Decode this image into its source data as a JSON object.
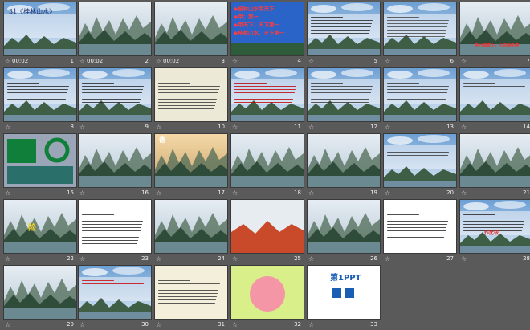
{
  "view": "slide-sorter",
  "slides": [
    {
      "number": "1",
      "timing": "00:02",
      "heading": "31《桂林山水》"
    },
    {
      "number": "2",
      "timing": "00:02"
    },
    {
      "number": "3",
      "timing": "00:02"
    },
    {
      "number": "4",
      "timing": "",
      "lines": [
        "◆桂林山水甲天下",
        "◆甲：第一",
        "◆甲天下：天下第一",
        "◆桂林山水，天下第一"
      ]
    },
    {
      "number": "5",
      "timing": ""
    },
    {
      "number": "6",
      "timing": ""
    },
    {
      "number": "7",
      "timing": "",
      "caption": "舟行碧波上，人在画中游"
    },
    {
      "number": "8",
      "timing": ""
    },
    {
      "number": "9",
      "timing": ""
    },
    {
      "number": "10",
      "timing": ""
    },
    {
      "number": "11",
      "timing": ""
    },
    {
      "number": "12",
      "timing": ""
    },
    {
      "number": "13",
      "timing": ""
    },
    {
      "number": "14",
      "timing": ""
    },
    {
      "number": "15",
      "timing": ""
    },
    {
      "number": "16",
      "timing": ""
    },
    {
      "number": "17",
      "timing": "",
      "caption": "奇"
    },
    {
      "number": "18",
      "timing": ""
    },
    {
      "number": "19",
      "timing": ""
    },
    {
      "number": "20",
      "timing": ""
    },
    {
      "number": "21",
      "timing": ""
    },
    {
      "number": "22",
      "timing": "",
      "caption": "险"
    },
    {
      "number": "23",
      "timing": ""
    },
    {
      "number": "24",
      "timing": ""
    },
    {
      "number": "25",
      "timing": ""
    },
    {
      "number": "26",
      "timing": ""
    },
    {
      "number": "27",
      "timing": ""
    },
    {
      "number": "28",
      "timing": "",
      "caption": "作比较"
    },
    {
      "number": "29",
      "timing": ""
    },
    {
      "number": "30",
      "timing": ""
    },
    {
      "number": "31",
      "timing": ""
    },
    {
      "number": "32",
      "timing": ""
    },
    {
      "number": "33",
      "timing": "",
      "caption": "第1PPT"
    }
  ],
  "colors": {
    "background": "#5a5a5a",
    "label": "#f0f0f0",
    "accent_red": "#d01010",
    "ppt_blue": "#1a5db5"
  }
}
